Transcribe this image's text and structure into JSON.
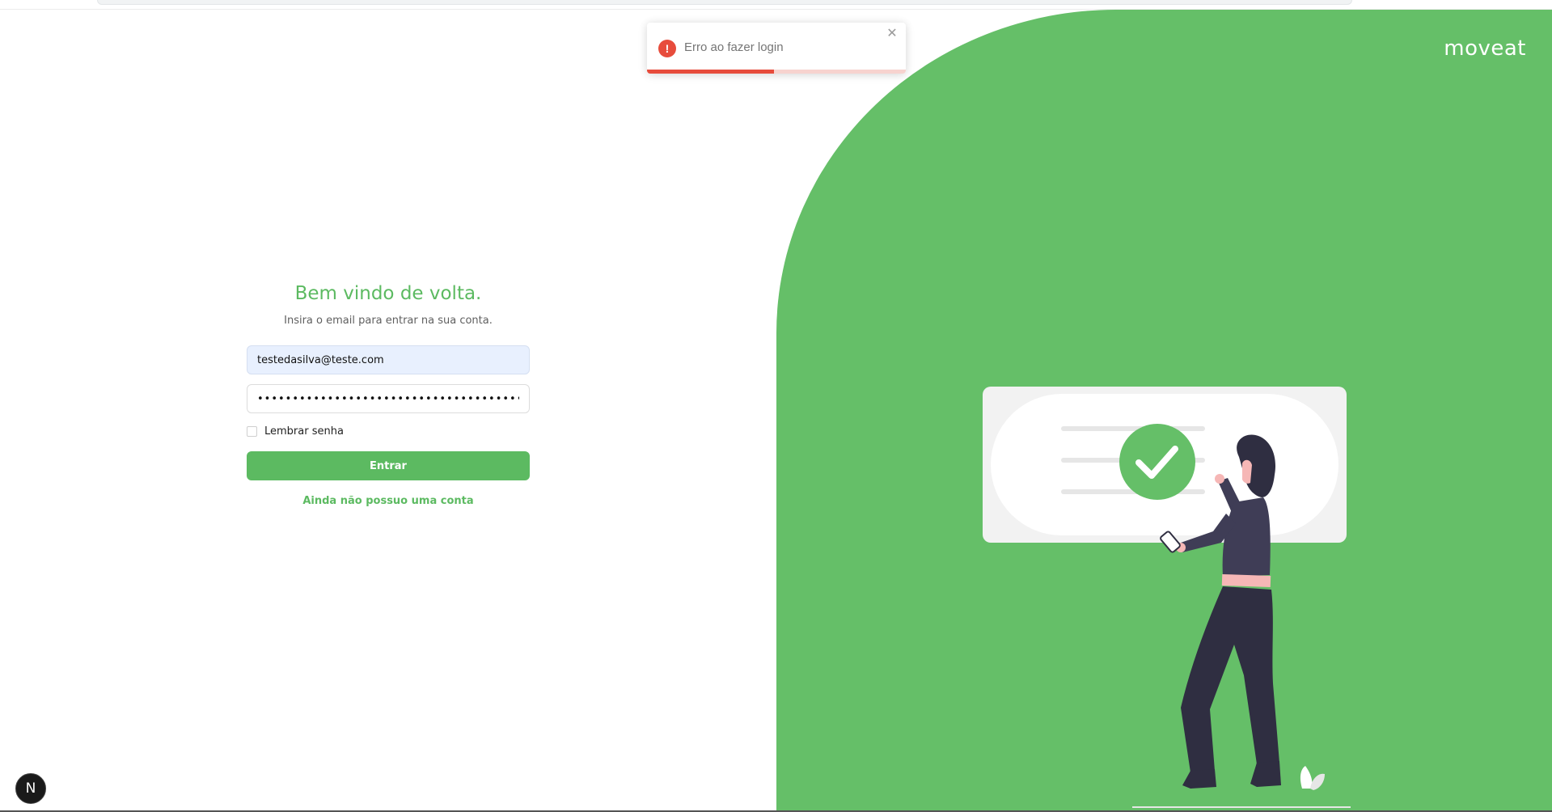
{
  "brand": {
    "name": "moveat"
  },
  "login": {
    "title": "Bem vindo de volta.",
    "subtitle": "Insira o email para entrar na sua conta.",
    "email_value": "testedasilva@teste.com",
    "password_value": "••••••••••••••••••••••••••••••••••••••••••",
    "remember_label": "Lembrar senha",
    "remember_checked": false,
    "submit_label": "Entrar",
    "signup_link": "Ainda não possuo uma conta"
  },
  "toast": {
    "message": "Erro ao fazer login",
    "icon": "error-exclamation-icon",
    "close_icon": "close-icon",
    "progress_fraction": 0.49,
    "color": "#e74c3c"
  },
  "dev_badge": {
    "label": "N"
  },
  "colors": {
    "primary": "#65bf68",
    "button": "#5cba61",
    "error": "#e74c3c"
  }
}
